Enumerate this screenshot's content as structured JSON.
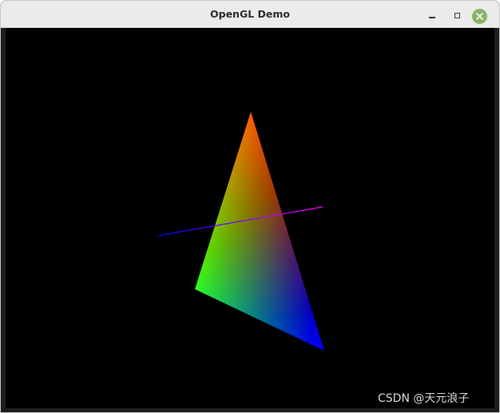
{
  "window": {
    "title": "OpenGL Demo"
  },
  "titlebar_controls": {
    "minimize_icon": "minimize-icon",
    "maximize_icon": "maximize-icon",
    "close_icon": "close-icon",
    "close_color": "#87b36a"
  },
  "scene": {
    "background": "#000000",
    "triangle": {
      "vertex_colors": [
        "#ff0000",
        "#00ff00",
        "#0000ff"
      ]
    },
    "line": {
      "start_color": "#0000ff",
      "end_color": "#ff00ff"
    }
  },
  "watermark": {
    "text": "CSDN @天元浪子"
  }
}
